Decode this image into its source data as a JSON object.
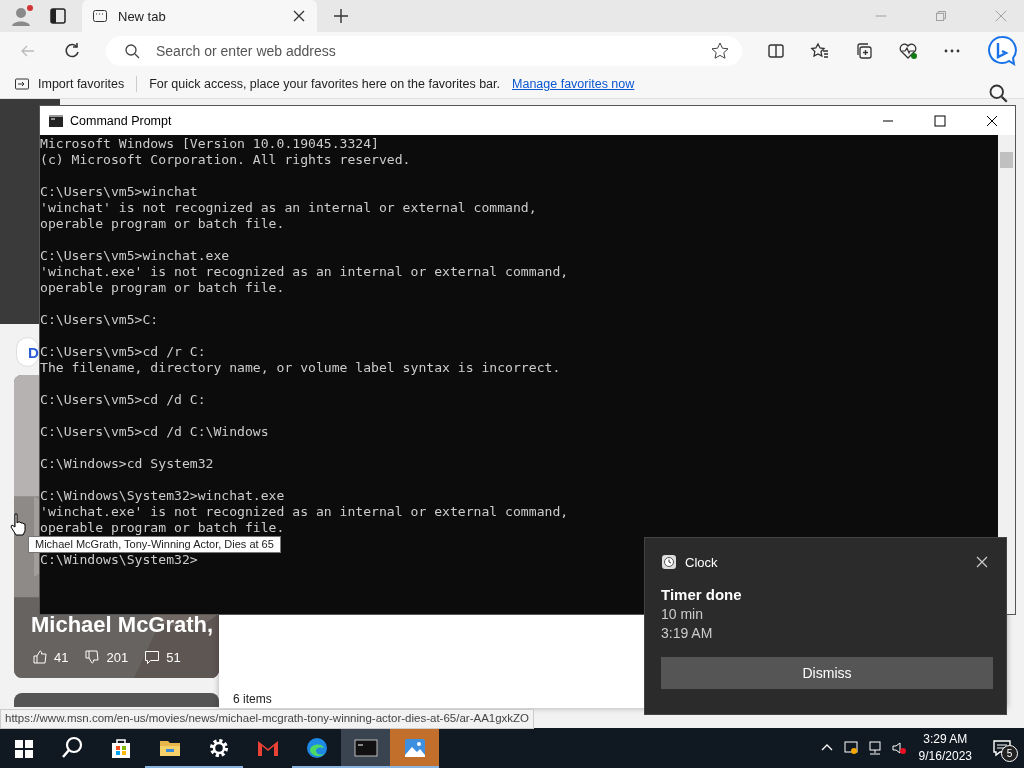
{
  "browser": {
    "tabs": [
      {
        "label": "New tab",
        "selected": true
      }
    ],
    "address": {
      "placeholder": "Search or enter web address"
    },
    "favorites": {
      "import_label": "Import favorites",
      "hint": "For quick access, place your favorites here on the favorites bar.",
      "link": "Manage favorites now"
    },
    "feed": {
      "chip": "D",
      "card": {
        "kind": "picture",
        "headline": "Michael McGrath,",
        "likes": "41",
        "dislikes": "201",
        "comments": "51"
      }
    },
    "tooltip": "Michael McGrath, Tony-Winning Actor, Dies at 65",
    "status_url": "https://www.msn.com/en-us/movies/news/michael-mcgrath-tony-winning-actor-dies-at-65/ar-AA1gxkZO"
  },
  "cmd": {
    "title": "Command Prompt",
    "blocks": [
      [
        "Microsoft Windows [Version 10.0.19045.3324]",
        "(c) Microsoft Corporation. All rights reserved."
      ],
      [
        "C:\\Users\\vm5>winchat",
        "'winchat' is not recognized as an internal or external command,",
        "operable program or batch file."
      ],
      [
        "C:\\Users\\vm5>winchat.exe",
        "'winchat.exe' is not recognized as an internal or external command,",
        "operable program or batch file."
      ],
      [
        "C:\\Users\\vm5>C:"
      ],
      [
        "C:\\Users\\vm5>cd /r C:",
        "The filename, directory name, or volume label syntax is incorrect."
      ],
      [
        "C:\\Users\\vm5>cd /d C:"
      ],
      [
        "C:\\Users\\vm5>cd /d C:\\Windows"
      ],
      [
        "C:\\Windows>cd System32"
      ],
      [
        "C:\\Windows\\System32>winchat.exe",
        "'winchat.exe' is not recognized as an internal or external command,",
        "operable program or batch file."
      ],
      [
        "C:\\Windows\\System32>"
      ]
    ]
  },
  "explorer": {
    "status": "6 items"
  },
  "notification": {
    "app": "Clock",
    "title": "Timer done",
    "lines": [
      "10 min",
      "3:19 AM"
    ],
    "button": "Dismiss"
  },
  "taskbar": {
    "apps": [
      {
        "kind": "store",
        "running": false,
        "selected": false,
        "flashing": false
      },
      {
        "kind": "folder",
        "running": true,
        "selected": false,
        "flashing": false
      },
      {
        "kind": "settings",
        "running": true,
        "selected": false,
        "flashing": false
      },
      {
        "kind": "mail",
        "running": false,
        "selected": false,
        "flashing": false
      },
      {
        "kind": "edge",
        "running": true,
        "selected": false,
        "flashing": false
      },
      {
        "kind": "terminal",
        "running": true,
        "selected": true,
        "flashing": false
      },
      {
        "kind": "photos",
        "running": true,
        "selected": false,
        "flashing": true
      }
    ],
    "time": "3:29 AM",
    "date": "9/16/2023",
    "notification_count": "5"
  }
}
